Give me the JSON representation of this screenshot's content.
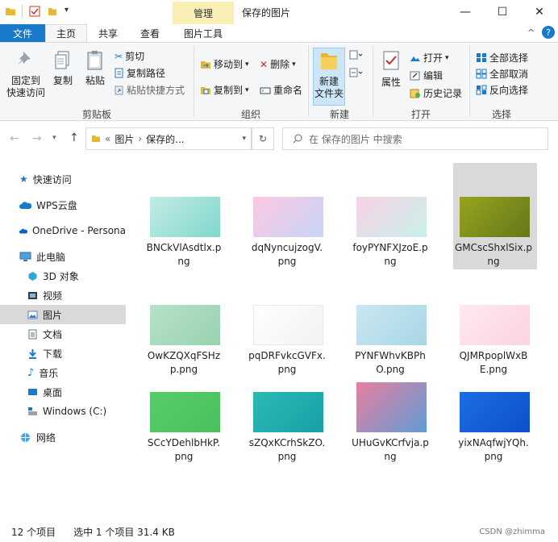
{
  "window": {
    "manage_label": "管理",
    "title": "保存的图片",
    "minimize": "—",
    "maximize": "☐",
    "close": "✕"
  },
  "tabs": [
    "文件",
    "主页",
    "共享",
    "查看",
    "图片工具"
  ],
  "ribbon": {
    "clipboard": {
      "pin_line1": "固定到",
      "pin_line2": "快速访问",
      "copy": "复制",
      "paste": "粘贴",
      "cut": "剪切",
      "copy_path": "复制路径",
      "paste_shortcut": "粘贴快捷方式",
      "group": "剪贴板"
    },
    "organize": {
      "move_to": "移动到",
      "copy_to": "复制到",
      "delete": "删除",
      "rename": "重命名",
      "group": "组织"
    },
    "new": {
      "new_folder_line1": "新建",
      "new_folder_line2": "文件夹",
      "group": "新建"
    },
    "open": {
      "properties": "属性",
      "open": "打开",
      "edit": "编辑",
      "history": "历史记录",
      "group": "打开"
    },
    "select": {
      "select_all": "全部选择",
      "select_none": "全部取消",
      "invert": "反向选择",
      "group": "选择"
    }
  },
  "address": {
    "prefix": "«",
    "crumb1": "图片",
    "sep": "›",
    "crumb2": "保存的...",
    "search_placeholder": "在 保存的图片 中搜索"
  },
  "nav": [
    {
      "label": "快速访问",
      "icon": "star-icon"
    },
    {
      "label": "WPS云盘",
      "icon": "cloud-icon"
    },
    {
      "label": "OneDrive - Persona",
      "icon": "onedrive-icon"
    },
    {
      "label": "此电脑",
      "icon": "computer-icon"
    },
    {
      "label": "3D 对象",
      "icon": "cube-icon"
    },
    {
      "label": "视频",
      "icon": "video-icon"
    },
    {
      "label": "图片",
      "icon": "pictures-icon"
    },
    {
      "label": "文档",
      "icon": "document-icon"
    },
    {
      "label": "下载",
      "icon": "download-icon"
    },
    {
      "label": "音乐",
      "icon": "music-icon"
    },
    {
      "label": "桌面",
      "icon": "desktop-icon"
    },
    {
      "label": "Windows  (C:)",
      "icon": "drive-icon"
    },
    {
      "label": "网络",
      "icon": "network-icon"
    }
  ],
  "files": [
    {
      "line1": "BNCkVlAsdtlx.p",
      "line2": "ng",
      "colors": [
        "#c4ece6",
        "#7fd7cb"
      ]
    },
    {
      "line1": "dqNyncujzogV.",
      "line2": "png",
      "colors": [
        "#fbc8e0",
        "#c8d4f8"
      ]
    },
    {
      "line1": "foyPYNFXJzoE.p",
      "line2": "ng",
      "colors": [
        "#f7d2e6",
        "#c9f0e9"
      ]
    },
    {
      "line1": "GMCscShxlSix.p",
      "line2": "ng",
      "colors": [
        "#97a41f",
        "#66771a"
      ]
    },
    {
      "line1": "OwKZQXqFSHz",
      "line2": "p.png",
      "colors": [
        "#b7e1c8",
        "#98d3b1"
      ]
    },
    {
      "line1": "pqDRFvkcGVFx.",
      "line2": "png",
      "colors": [
        "#ffffff",
        "#f2f2f6"
      ]
    },
    {
      "line1": "PYNFWhvKBPh",
      "line2": "O.png",
      "colors": [
        "#cbe7f1",
        "#a8d6e6"
      ]
    },
    {
      "line1": "QJMRpoplWxB",
      "line2": "E.png",
      "colors": [
        "#ffe9ef",
        "#fbd4de"
      ]
    },
    {
      "line1": "SCcYDehlbHkP.",
      "line2": "png",
      "colors": [
        "#58cc6a",
        "#4bc060"
      ]
    },
    {
      "line1": "sZQxKCrhSkZO.",
      "line2": "png",
      "colors": [
        "#2cb9b4",
        "#17a1a7"
      ]
    },
    {
      "line1": "UHuGvKCrfvja.p",
      "line2": "ng",
      "colors": [
        "#e87fa0",
        "#5f9cd6"
      ]
    },
    {
      "line1": "yixNAqfwjYQh.",
      "line2": "png",
      "colors": [
        "#1c6ee4",
        "#0d4fcc"
      ]
    }
  ],
  "status": {
    "count": "12 个项目",
    "selection": "选中 1 个项目  31.4 KB"
  },
  "watermark": "CSDN @zhimma"
}
